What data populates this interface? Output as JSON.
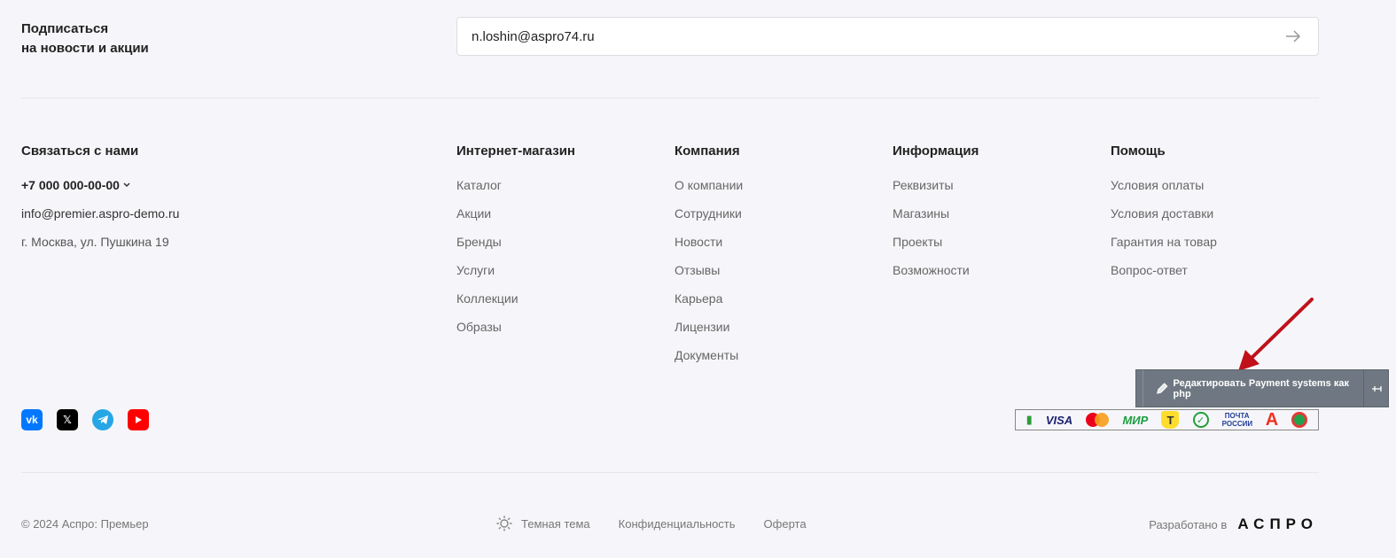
{
  "subscribe": {
    "title_line1": "Подписаться",
    "title_line2": "на новости и акции",
    "email_value": "n.loshin@aspro74.ru"
  },
  "contacts": {
    "title": "Связаться с нами",
    "phone": "+7 000 000-00-00",
    "email": "info@premier.aspro-demo.ru",
    "address": "г. Москва, ул. Пушкина 19"
  },
  "columns": [
    {
      "title": "Интернет-магазин",
      "links": [
        "Каталог",
        "Акции",
        "Бренды",
        "Услуги",
        "Коллекции",
        "Образы"
      ]
    },
    {
      "title": "Компания",
      "links": [
        "О компании",
        "Сотрудники",
        "Новости",
        "Отзывы",
        "Карьера",
        "Лицензии",
        "Документы"
      ]
    },
    {
      "title": "Информация",
      "links": [
        "Реквизиты",
        "Магазины",
        "Проекты",
        "Возможности"
      ]
    },
    {
      "title": "Помощь",
      "links": [
        "Условия оплаты",
        "Условия доставки",
        "Гарантия на товар",
        "Вопрос-ответ"
      ]
    }
  ],
  "socials": [
    "vk-icon",
    "x-icon",
    "telegram-icon",
    "youtube-icon"
  ],
  "payments": [
    "sbp",
    "VISA",
    "mastercard",
    "МИР",
    "tinkoff",
    "sber",
    "ПОЧТА РОССИИ",
    "alfa",
    "sovcom"
  ],
  "edit_panel": {
    "label": "Редактировать Payment systems как php"
  },
  "bottom": {
    "copyright": "© 2024 Аспро: Премьер",
    "theme": "Темная тема",
    "privacy": "Конфиденциальность",
    "offer": "Оферта",
    "developed": "Разработано в",
    "dev_logo": "АСПРО"
  },
  "colors": {
    "background": "#f6f6fa",
    "edit_panel": "#6f7882",
    "arrow": "#c0111a"
  }
}
